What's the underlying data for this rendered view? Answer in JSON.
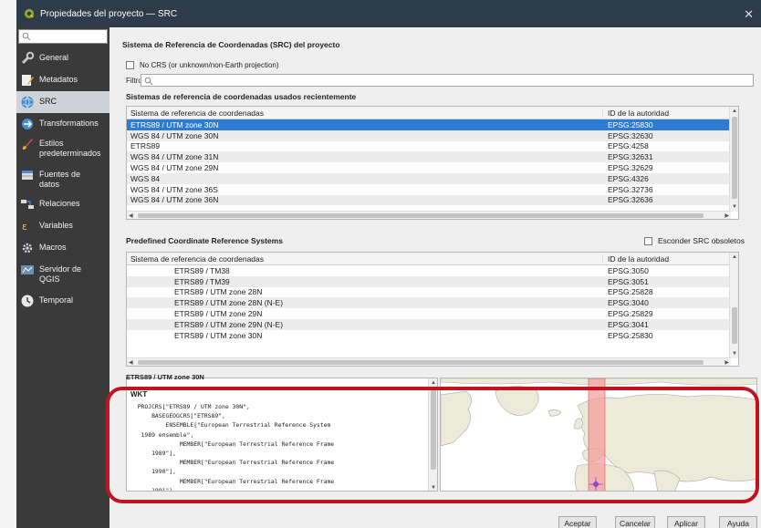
{
  "window": {
    "title": "Propiedades del proyecto — SRC",
    "close_glyph": "✕"
  },
  "sidebar": {
    "items": [
      {
        "label": "General",
        "icon": "wrench-icon"
      },
      {
        "label": "Metadatos",
        "icon": "pencil-icon"
      },
      {
        "label": "SRC",
        "icon": "globe-icon"
      },
      {
        "label": "Transformations",
        "icon": "transform-icon"
      },
      {
        "label": "Estilos predeterminados",
        "icon": "brush-icon"
      },
      {
        "label": "Fuentes de datos",
        "icon": "datasource-icon"
      },
      {
        "label": "Relaciones",
        "icon": "relations-icon"
      },
      {
        "label": "Variables",
        "icon": "variables-icon"
      },
      {
        "label": "Macros",
        "icon": "macros-icon"
      },
      {
        "label": "Servidor de QGIS",
        "icon": "server-icon"
      },
      {
        "label": "Temporal",
        "icon": "clock-icon"
      }
    ],
    "active_index": 2
  },
  "main": {
    "section_title": "Sistema de Referencia de Coordenadas (SRC) del proyecto",
    "no_crs_label": "No CRS (or unknown/non-Earth projection)",
    "filter_label": "Filtro",
    "recent": {
      "title": "Sistemas de referencia de coordenadas usados recientemente",
      "col1": "Sistema de referencia de coordenadas",
      "col2": "ID de la autoridad",
      "rows": [
        {
          "name": "ETRS89 / UTM zone 30N",
          "id": "EPSG:25830"
        },
        {
          "name": "WGS 84 / UTM zone 30N",
          "id": "EPSG:32630"
        },
        {
          "name": "ETRS89",
          "id": "EPSG:4258"
        },
        {
          "name": "WGS 84 / UTM zone 31N",
          "id": "EPSG:32631"
        },
        {
          "name": "WGS 84 / UTM zone 29N",
          "id": "EPSG:32629"
        },
        {
          "name": "WGS 84",
          "id": "EPSG:4326"
        },
        {
          "name": "WGS 84 / UTM zone 36S",
          "id": "EPSG:32736"
        },
        {
          "name": "WGS 84 / UTM zone 36N",
          "id": "EPSG:32636"
        }
      ],
      "selected_index": 0
    },
    "predefined": {
      "title": "Predefined Coordinate Reference Systems",
      "hide_obsolete_label": "Esconder SRC obsoletos",
      "col1": "Sistema de referencia de coordenadas",
      "col2": "ID de la autoridad",
      "rows": [
        {
          "name": "ETRS89 / TM38",
          "id": "EPSG:3050"
        },
        {
          "name": "ETRS89 / TM39",
          "id": "EPSG:3051"
        },
        {
          "name": "ETRS89 / UTM zone 28N",
          "id": "EPSG:25828"
        },
        {
          "name": "ETRS89 / UTM zone 28N (N-E)",
          "id": "EPSG:3040"
        },
        {
          "name": "ETRS89 / UTM zone 29N",
          "id": "EPSG:25829"
        },
        {
          "name": "ETRS89 / UTM zone 29N (N-E)",
          "id": "EPSG:3041"
        },
        {
          "name": "ETRS89 / UTM zone 30N",
          "id": "EPSG:25830"
        }
      ]
    },
    "selected_crs_label": "ETRS89 / UTM zone 30N",
    "wkt": {
      "title": "WKT",
      "text": "  PROJCRS[\"ETRS89 / UTM zone 30N\",\n      BASEGEOGCRS[\"ETRS89\",\n          ENSEMBLE[\"European Terrestrial Reference System\n   1989 ensemble\",\n              MEMBER[\"European Terrestrial Reference Frame\n      1989\"],\n              MEMBER[\"European Terrestrial Reference Frame\n      1990\"],\n              MEMBER[\"European Terrestrial Reference Frame\n      1991\"],"
    }
  },
  "buttons": {
    "accept": "Aceptar",
    "cancel": "Cancelar",
    "apply": "Aplicar",
    "help": "Ayuda"
  },
  "colors": {
    "title_bar": "#2e3b48",
    "sidebar": "#3a3a3a",
    "selection": "#2d7bd2",
    "highlight": "#c0141e",
    "map_zone": "#f4a0a0"
  }
}
